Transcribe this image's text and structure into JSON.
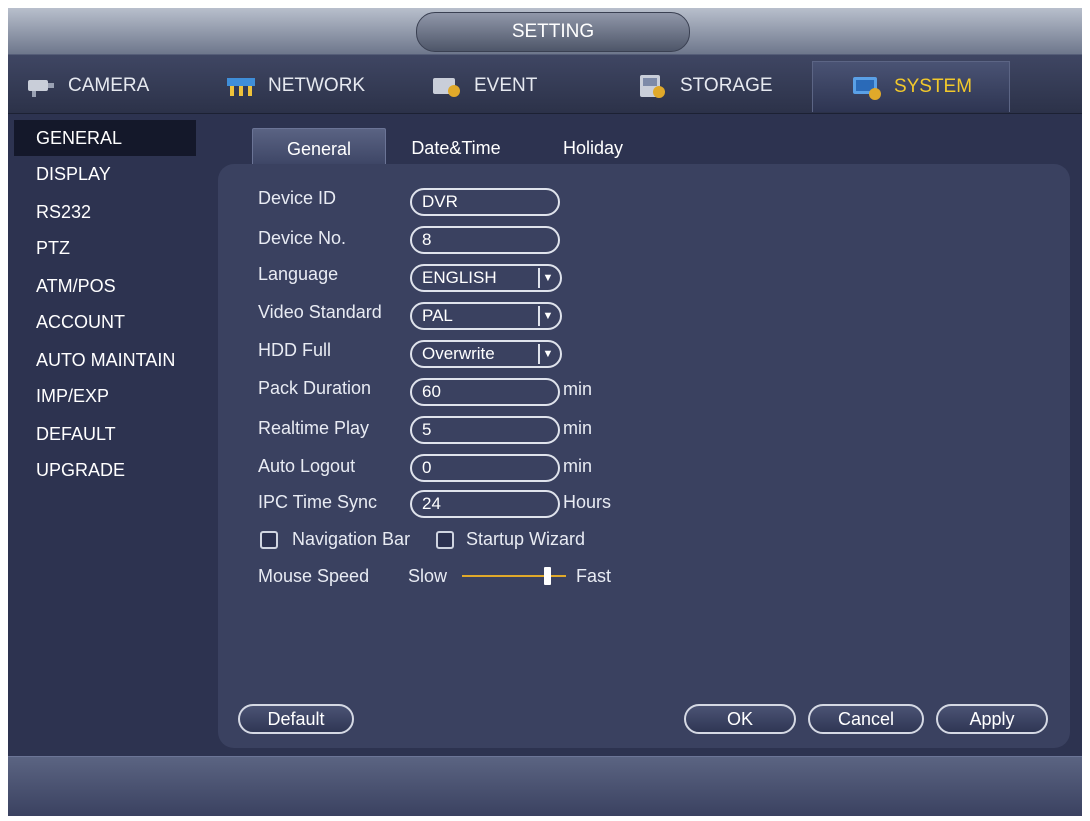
{
  "window": {
    "title": "SETTING"
  },
  "main_tabs": [
    {
      "label": "CAMERA",
      "icon": "camera-icon"
    },
    {
      "label": "NETWORK",
      "icon": "network-icon"
    },
    {
      "label": "EVENT",
      "icon": "event-icon"
    },
    {
      "label": "STORAGE",
      "icon": "storage-icon"
    },
    {
      "label": "SYSTEM",
      "icon": "system-icon",
      "active": true
    }
  ],
  "sidebar": {
    "items": [
      {
        "label": "GENERAL",
        "active": true
      },
      {
        "label": "DISPLAY"
      },
      {
        "label": "RS232"
      },
      {
        "label": "PTZ"
      },
      {
        "label": "ATM/POS"
      },
      {
        "label": "ACCOUNT"
      },
      {
        "label": "AUTO MAINTAIN"
      },
      {
        "label": "IMP/EXP"
      },
      {
        "label": "DEFAULT"
      },
      {
        "label": "UPGRADE"
      }
    ]
  },
  "sub_tabs": [
    {
      "label": "General",
      "active": true
    },
    {
      "label": "Date&Time"
    },
    {
      "label": "Holiday"
    }
  ],
  "form": {
    "device_id": {
      "label": "Device ID",
      "value": "DVR"
    },
    "device_no": {
      "label": "Device No.",
      "value": "8"
    },
    "language": {
      "label": "Language",
      "value": "ENGLISH"
    },
    "video_standard": {
      "label": "Video Standard",
      "value": "PAL"
    },
    "hdd_full": {
      "label": "HDD Full",
      "value": "Overwrite"
    },
    "pack_duration": {
      "label": "Pack Duration",
      "value": "60",
      "unit": "min"
    },
    "realtime_play": {
      "label": "Realtime Play",
      "value": "5",
      "unit": "min"
    },
    "auto_logout": {
      "label": "Auto Logout",
      "value": "0",
      "unit": "min"
    },
    "ipc_time_sync": {
      "label": "IPC Time Sync",
      "value": "24",
      "unit": "Hours"
    },
    "navigation_bar": {
      "label": "Navigation Bar",
      "checked": false
    },
    "startup_wizard": {
      "label": "Startup Wizard",
      "checked": false
    },
    "mouse_speed": {
      "label": "Mouse Speed",
      "slow": "Slow",
      "fast": "Fast",
      "level": 0.85
    }
  },
  "buttons": {
    "default": "Default",
    "ok": "OK",
    "cancel": "Cancel",
    "apply": "Apply"
  },
  "colors": {
    "active_tab": "#f2c92b",
    "background": "#2d3350",
    "panel": "#3a4160"
  }
}
